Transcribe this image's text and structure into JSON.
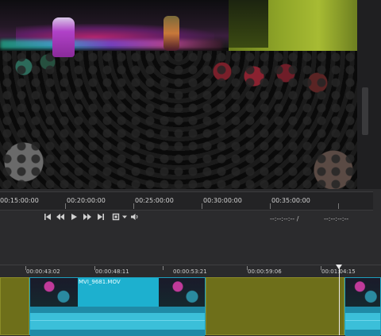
{
  "viewer": {
    "ruler_labels": [
      "00:15:00:00",
      "00:20:00:00",
      "00:25:00:00",
      "00:30:00:00",
      "00:35:00:00"
    ]
  },
  "transport": {
    "icons": {
      "go_start": "skip-to-start-icon",
      "rewind": "rewind-icon",
      "play": "play-icon",
      "fast_forward": "fast-forward-icon",
      "go_end": "skip-to-end-icon",
      "fit": "fit-to-screen-icon",
      "menu": "chevron-down-icon",
      "volume": "volume-icon"
    },
    "timecode_current": "--:--:--:-- /",
    "timecode_total": "--:--:--:--"
  },
  "timeline": {
    "ruler_labels": [
      "00:00:43:02",
      "00:00:48:11",
      "00:00:53:21",
      "00:00:59:06",
      "00:01:04:15"
    ],
    "clip_name": "MVI_9681.MOV"
  },
  "colors": {
    "gap_clip": "#6e6f1a",
    "video_clip": "#1d6f8a",
    "clip_title": "#1db0cf"
  }
}
